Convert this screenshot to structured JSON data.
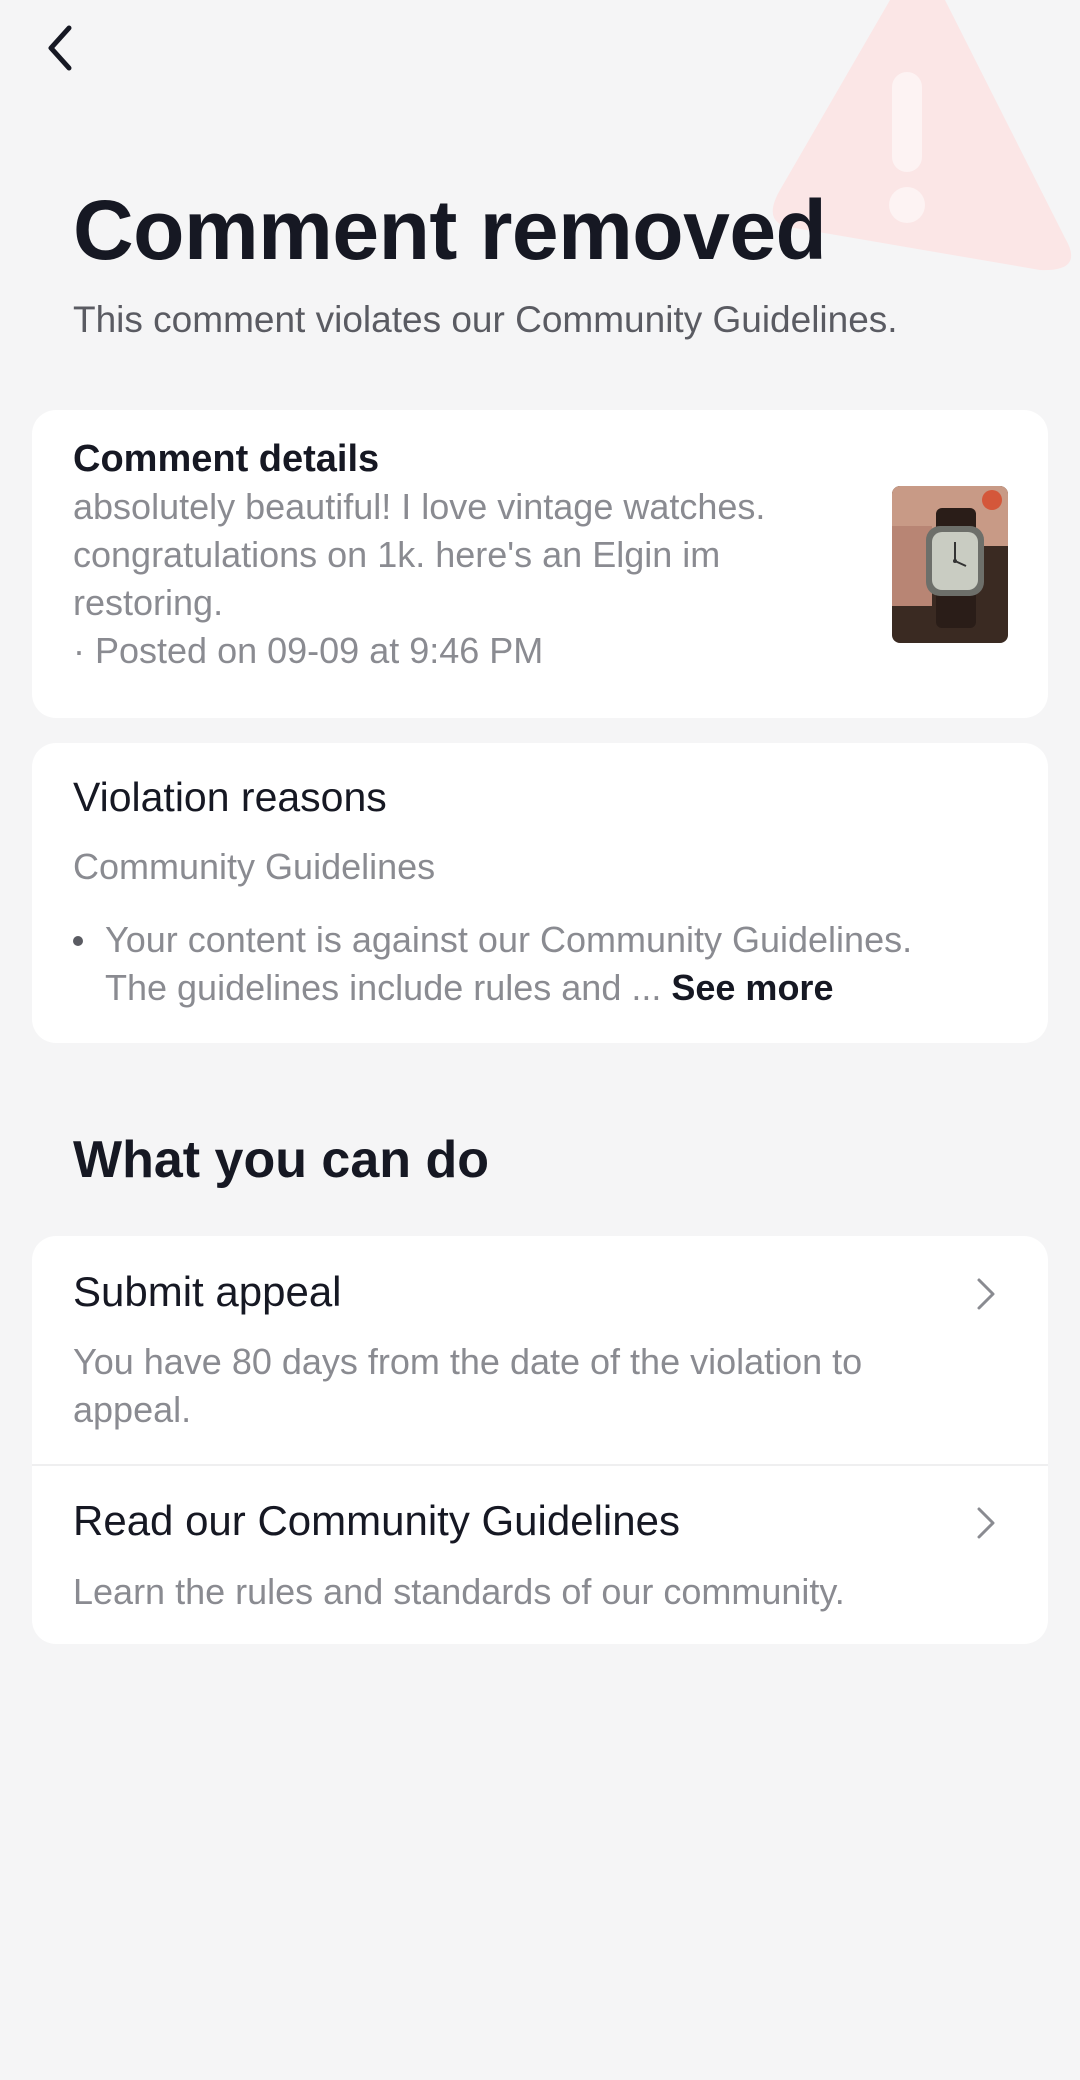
{
  "header": {
    "title": "Comment removed",
    "subtitle": "This comment violates our Community Guidelines."
  },
  "icons": {
    "back": "chevron-left-icon",
    "background": "warning-triangle-icon",
    "row_chevron": "chevron-right-icon"
  },
  "comment_details": {
    "heading": "Comment details",
    "text_lines": [
      "absolutely beautiful! I love vintage watches.",
      "congratulations on 1k. here's an Elgin im",
      "restoring.",
      "· Posted on 09-09 at 9:46 PM"
    ]
  },
  "violation": {
    "heading": "Violation reasons",
    "category": "Community Guidelines",
    "reason_line1": "Your content is against our Community Guidelines.",
    "reason_line2": "The guidelines include rules and ...",
    "see_more": "See more"
  },
  "actions": {
    "heading": "What you can do",
    "items": [
      {
        "title": "Submit appeal",
        "description_lines": [
          "You have 80 days from the date of the violation to",
          "appeal."
        ]
      },
      {
        "title": "Read our Community Guidelines",
        "description_lines": [
          "Learn the rules and standards of our community."
        ]
      }
    ]
  },
  "colors": {
    "background": "#f5f5f6",
    "card": "#ffffff",
    "primary_text": "#161823",
    "secondary_text": "#8a8b91",
    "warning_tint": "#fbe3e3"
  }
}
